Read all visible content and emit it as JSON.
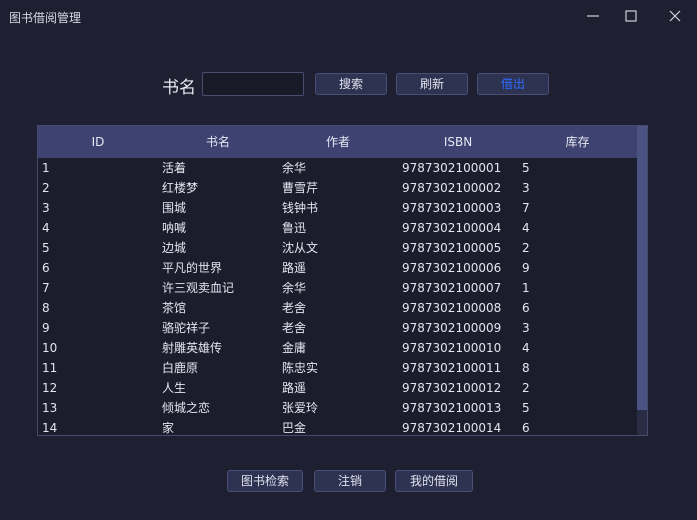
{
  "window": {
    "title": "图书借阅管理"
  },
  "search": {
    "label": "书名",
    "value": "",
    "placeholder": ""
  },
  "toolbar": {
    "search": "搜索",
    "refresh": "刷新",
    "borrow": "借出"
  },
  "table": {
    "columns": [
      "ID",
      "书名",
      "作者",
      "ISBN",
      "库存"
    ],
    "rows": [
      [
        "1",
        "活着",
        "余华",
        "9787302100001",
        "5"
      ],
      [
        "2",
        "红楼梦",
        "曹雪芹",
        "9787302100002",
        "3"
      ],
      [
        "3",
        "围城",
        "钱钟书",
        "9787302100003",
        "7"
      ],
      [
        "4",
        "呐喊",
        "鲁迅",
        "9787302100004",
        "4"
      ],
      [
        "5",
        "边城",
        "沈从文",
        "9787302100005",
        "2"
      ],
      [
        "6",
        "平凡的世界",
        "路遥",
        "9787302100006",
        "9"
      ],
      [
        "7",
        "许三观卖血记",
        "余华",
        "9787302100007",
        "1"
      ],
      [
        "8",
        "茶馆",
        "老舍",
        "9787302100008",
        "6"
      ],
      [
        "9",
        "骆驼祥子",
        "老舍",
        "9787302100009",
        "3"
      ],
      [
        "10",
        "射雕英雄传",
        "金庸",
        "9787302100010",
        "4"
      ],
      [
        "11",
        "白鹿原",
        "陈忠实",
        "9787302100011",
        "8"
      ],
      [
        "12",
        "人生",
        "路遥",
        "9787302100012",
        "2"
      ],
      [
        "13",
        "倾城之恋",
        "张爱玲",
        "9787302100013",
        "5"
      ],
      [
        "14",
        "家",
        "巴金",
        "9787302100014",
        "6"
      ]
    ]
  },
  "footer": {
    "book_search": "图书检索",
    "logout": "注销",
    "my_borrows": "我的借阅"
  },
  "icons": {
    "minimize": "minimize-icon",
    "maximize": "maximize-icon",
    "close": "close-icon"
  },
  "colors": {
    "background": "#1e1f30",
    "header": "#3e4270",
    "accent_text": "#2f6bff"
  }
}
